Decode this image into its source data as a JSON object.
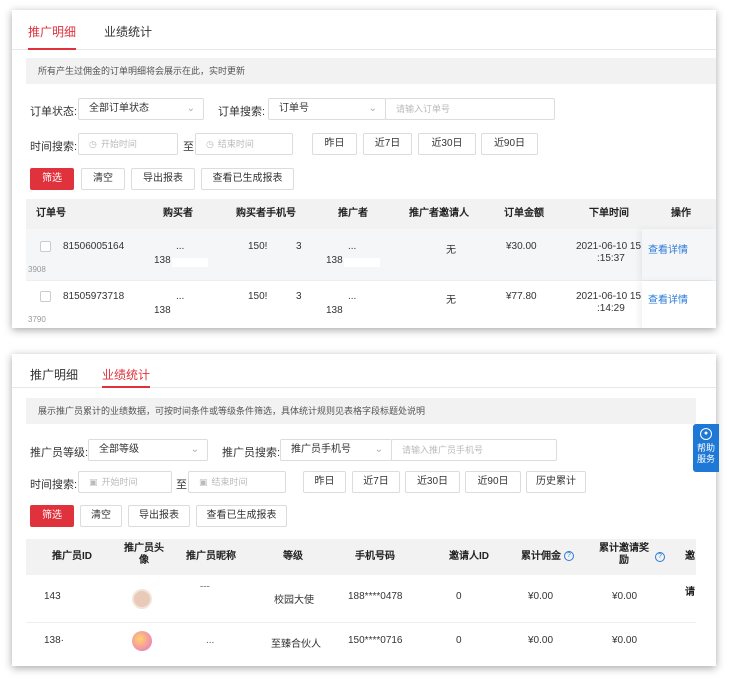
{
  "panel1": {
    "tabs": [
      {
        "label": "推广明细",
        "active": true
      },
      {
        "label": "业绩统计",
        "active": false
      }
    ],
    "notice": "所有产生过佣金的订单明细将会展示在此，实时更新",
    "filters": {
      "order_status_label": "订单状态:",
      "order_status_value": "全部订单状态",
      "order_search_label": "订单搜索:",
      "order_search_type": "订单号",
      "order_search_placeholder": "请输入订单号",
      "time_label": "时间搜索:",
      "start_placeholder": "开始时间",
      "to": "至",
      "end_placeholder": "结束时间",
      "quick": [
        "昨日",
        "近7日",
        "近30日",
        "近90日"
      ]
    },
    "actions": {
      "filter": "筛选",
      "clear": "清空",
      "export": "导出报表",
      "view_reports": "查看已生成报表"
    },
    "columns": [
      "订单号",
      "购买者",
      "购买者手机号",
      "推广者",
      "推广者邀请人",
      "订单金额",
      "下单时间",
      "操作"
    ],
    "rows": [
      {
        "order_no": "81506005164",
        "order_no_tail": "3908",
        "buyer": "...",
        "buyer_id": "138",
        "phone": "150!",
        "phone_tail": "3",
        "promoter": "...",
        "promoter_id": "138",
        "inviter": "无",
        "amount": "¥30.00",
        "date": "2021-06-10 15",
        "time": ":15:37",
        "action": "查看详情"
      },
      {
        "order_no": "81505973718",
        "order_no_tail": "3790",
        "buyer": "...",
        "buyer_id": "138",
        "phone": "150!",
        "phone_tail": "3",
        "promoter": "...",
        "promoter_id": "138",
        "inviter": "无",
        "amount": "¥77.80",
        "date": "2021-06-10 15",
        "time": ":14:29",
        "action": "查看详情"
      }
    ]
  },
  "panel2": {
    "tabs": [
      {
        "label": "推广明细",
        "active": false
      },
      {
        "label": "业绩统计",
        "active": true
      }
    ],
    "notice": "展示推广员累计的业绩数据，可按时间条件或等级条件筛选，具体统计规则见表格字段标题处说明",
    "filters": {
      "level_label": "推广员等级:",
      "level_value": "全部等级",
      "search_label": "推广员搜索:",
      "search_type": "推广员手机号",
      "search_placeholder": "请输入推广员手机号",
      "time_label": "时间搜索:",
      "start_placeholder": "开始时间",
      "to": "至",
      "end_placeholder": "结束时间",
      "quick": [
        "昨日",
        "近7日",
        "近30日",
        "近90日",
        "历史累计"
      ]
    },
    "actions": {
      "filter": "筛选",
      "clear": "清空",
      "export": "导出报表",
      "view_reports": "查看已生成报表"
    },
    "columns": [
      "推广员ID",
      "推广员头像",
      "推广员昵称",
      "等级",
      "手机号码",
      "邀请人ID",
      "累计佣金",
      "累计邀请奖励",
      "邀请"
    ],
    "rows": [
      {
        "id": "143",
        "nickname": "ˉˉˉ",
        "level": "校园大使",
        "phone": "188****0478",
        "inviter_id": "0",
        "commission": "¥0.00",
        "reward": "¥0.00",
        "avatar_color": "#e9c9b8"
      },
      {
        "id": "138·",
        "nickname": "...",
        "level": "至臻合伙人",
        "phone": "150****0716",
        "inviter_id": "0",
        "commission": "¥0.00",
        "reward": "¥0.00",
        "avatar_color": "#f08bb0"
      }
    ]
  },
  "help": {
    "line1": "帮助",
    "line2": "服务"
  },
  "colors": {
    "accent": "#e0323c",
    "link": "#2a7ad8",
    "help": "#1e78d6"
  }
}
